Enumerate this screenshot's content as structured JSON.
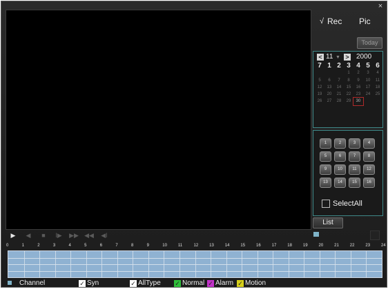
{
  "window": {
    "close_glyph": "×"
  },
  "sidebar": {
    "mode_options": [
      {
        "label": "Rec",
        "selected": true,
        "mark": "√"
      },
      {
        "label": "Pic",
        "selected": false,
        "mark": ""
      }
    ],
    "today_label": "Today",
    "calendar": {
      "month": "11",
      "year": "2000",
      "prev_glyph": "<",
      "next_glyph": ">",
      "dropdown_glyph": "▼",
      "weekday_headers": [
        "7",
        "1",
        "2",
        "3",
        "4",
        "5",
        "6"
      ],
      "weeks": [
        [
          "",
          "",
          "",
          "1",
          "2",
          "3",
          "4"
        ],
        [
          "5",
          "6",
          "7",
          "8",
          "9",
          "10",
          "11"
        ],
        [
          "12",
          "13",
          "14",
          "15",
          "16",
          "17",
          "18"
        ],
        [
          "19",
          "20",
          "21",
          "22",
          "23",
          "24",
          "25"
        ],
        [
          "26",
          "27",
          "28",
          "29",
          "30",
          "",
          ""
        ]
      ],
      "selected_day": "30"
    },
    "channels": [
      "1",
      "2",
      "3",
      "4",
      "5",
      "6",
      "7",
      "8",
      "9",
      "10",
      "11",
      "12",
      "13",
      "14",
      "15",
      "16"
    ],
    "select_all_label": "SelectAll",
    "list_label": "List"
  },
  "controls": {
    "play": "▶",
    "slow_back": "◀",
    "stop": "■",
    "step_fwd": "I▶",
    "fast_fwd": "▶▶",
    "fast_back": "◀◀",
    "step_back": "◀I"
  },
  "timeline": {
    "hours": [
      "0",
      "1",
      "2",
      "3",
      "4",
      "5",
      "6",
      "7",
      "8",
      "9",
      "10",
      "11",
      "12",
      "13",
      "14",
      "15",
      "16",
      "17",
      "18",
      "19",
      "20",
      "21",
      "22",
      "23",
      "24"
    ],
    "track_color": "#8fb2d2"
  },
  "legend": {
    "channel_label": "Channel",
    "syn_label": "Syn",
    "alltype_label": "AllType",
    "normal_label": "Normal",
    "alarm_label": "Alarm",
    "motion_label": "Motion",
    "check_mark": "✓",
    "colors": {
      "normal": "#2fbf3a",
      "alarm": "#c233c9",
      "motion": "#d6cf1a",
      "checkbox": "#ffffff"
    }
  }
}
